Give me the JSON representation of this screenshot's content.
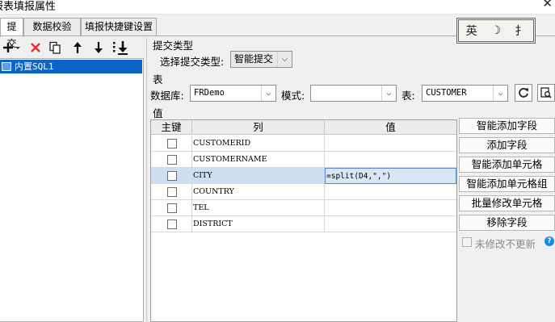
{
  "window": {
    "title": "报表填报属性",
    "close_glyph": "✕"
  },
  "tabs": [
    {
      "label": "提交"
    },
    {
      "label": "数据校验"
    },
    {
      "label": "填报快捷键设置"
    }
  ],
  "toolbar": {
    "icons": [
      "add-icon",
      "delete-icon",
      "copy-icon",
      "arrow-up-icon",
      "arrow-down-icon",
      "move-bottom-icon"
    ]
  },
  "left_list": {
    "items": [
      {
        "label": "内置SQL1"
      }
    ]
  },
  "submit_type": {
    "section": "提交类型",
    "label": "选择提交类型:",
    "value": "智能提交"
  },
  "table_section": {
    "section": "表",
    "db_label": "数据库:",
    "db_value": "FRDemo",
    "mode_label": "模式:",
    "mode_value": "",
    "table_label": "表:",
    "table_value": "CUSTOMER"
  },
  "value_section": {
    "section": "值",
    "headers": {
      "key": "主键",
      "column": "列",
      "value": "值"
    },
    "rows": [
      {
        "column": "CUSTOMERID",
        "value": "",
        "key": false,
        "selected": false
      },
      {
        "column": "CUSTOMERNAME",
        "value": "",
        "key": false,
        "selected": false
      },
      {
        "column": "CITY",
        "value": "=split(D4,\",\")",
        "key": false,
        "selected": true
      },
      {
        "column": "COUNTRY",
        "value": "",
        "key": false,
        "selected": false
      },
      {
        "column": "TEL",
        "value": "",
        "key": false,
        "selected": false
      },
      {
        "column": "DISTRICT",
        "value": "",
        "key": false,
        "selected": false
      }
    ]
  },
  "actions": {
    "smart_add_field": "智能添加字段",
    "add_field": "添加字段",
    "smart_add_cell": "智能添加单元格",
    "smart_add_cell_group": "智能添加单元格组",
    "batch_modify_cell": "批量修改单元格",
    "remove_field": "移除字段"
  },
  "no_update_checkbox": {
    "label": "未修改不更新",
    "checked": false
  },
  "ime": {
    "lang": "英",
    "moon": "☽",
    "mode": "⺘"
  },
  "colors": {
    "selection": "#0e64c6",
    "selected_row": "#cddff0",
    "help": "#1e88e5"
  }
}
